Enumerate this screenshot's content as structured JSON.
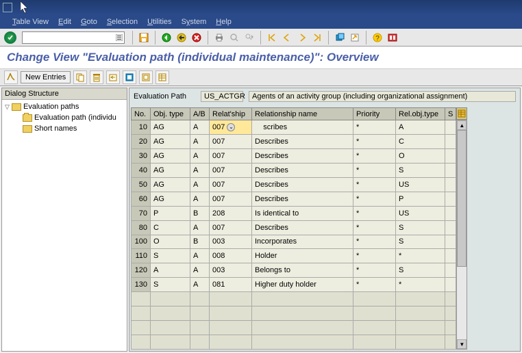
{
  "menubar": [
    "Table View",
    "Edit",
    "Goto",
    "Selection",
    "Utilities",
    "System",
    "Help"
  ],
  "page_title": "Change View \"Evaluation path (individual maintenance)\": Overview",
  "app_toolbar": {
    "new_entries": "New Entries"
  },
  "tree": {
    "header": "Dialog Structure",
    "root": "Evaluation paths",
    "child1": "Evaluation path (individual maintenance)",
    "child2": "Short names"
  },
  "eval": {
    "label": "Evaluation Path",
    "code": "US_ACTGR",
    "desc": "Agents of an activity group (including organizational assignment)"
  },
  "grid": {
    "headers": {
      "no": "No.",
      "obj": "Obj. type",
      "ab": "A/B",
      "rel": "Relat'ship",
      "relname": "Relationship name",
      "prio": "Priority",
      "robj": "Rel.obj.type",
      "s": "S"
    },
    "rows": [
      {
        "no": "10",
        "obj": "AG",
        "ab": "A",
        "rel": "007",
        "relname": "Describes",
        "prio": "*",
        "robj": "A",
        "active": true
      },
      {
        "no": "20",
        "obj": "AG",
        "ab": "A",
        "rel": "007",
        "relname": "Describes",
        "prio": "*",
        "robj": "C"
      },
      {
        "no": "30",
        "obj": "AG",
        "ab": "A",
        "rel": "007",
        "relname": "Describes",
        "prio": "*",
        "robj": "O"
      },
      {
        "no": "40",
        "obj": "AG",
        "ab": "A",
        "rel": "007",
        "relname": "Describes",
        "prio": "*",
        "robj": "S"
      },
      {
        "no": "50",
        "obj": "AG",
        "ab": "A",
        "rel": "007",
        "relname": "Describes",
        "prio": "*",
        "robj": "US"
      },
      {
        "no": "60",
        "obj": "AG",
        "ab": "A",
        "rel": "007",
        "relname": "Describes",
        "prio": "*",
        "robj": "P"
      },
      {
        "no": "70",
        "obj": "P",
        "ab": "B",
        "rel": "208",
        "relname": "Is identical to",
        "prio": "*",
        "robj": "US"
      },
      {
        "no": "80",
        "obj": "C",
        "ab": "A",
        "rel": "007",
        "relname": "Describes",
        "prio": "*",
        "robj": "S"
      },
      {
        "no": "100",
        "obj": "O",
        "ab": "B",
        "rel": "003",
        "relname": "Incorporates",
        "prio": "*",
        "robj": "S"
      },
      {
        "no": "110",
        "obj": "S",
        "ab": "A",
        "rel": "008",
        "relname": "Holder",
        "prio": "*",
        "robj": "*"
      },
      {
        "no": "120",
        "obj": "A",
        "ab": "A",
        "rel": "003",
        "relname": "Belongs to",
        "prio": "*",
        "robj": "S"
      },
      {
        "no": "130",
        "obj": "S",
        "ab": "A",
        "rel": "081",
        "relname": "Higher duty holder",
        "prio": "*",
        "robj": "*"
      }
    ]
  }
}
